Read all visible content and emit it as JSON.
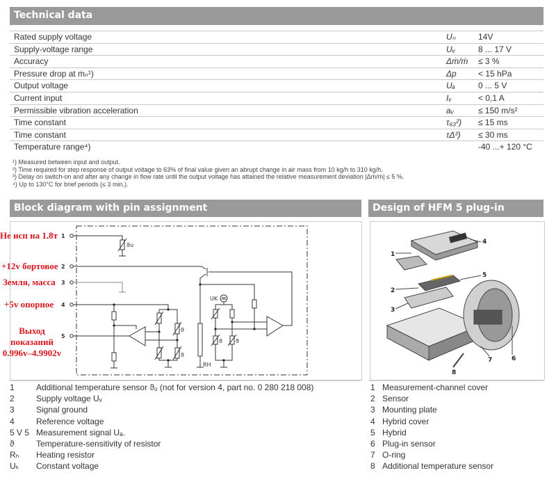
{
  "tech": {
    "title": "Technical data",
    "rows": [
      {
        "label": "Rated supply voltage",
        "symbol": "Uₙ",
        "value": "14V"
      },
      {
        "label": "Supply-voltage range",
        "symbol": "Uᵥ",
        "value": "8 ... 17 V"
      },
      {
        "label": "Accuracy",
        "symbol": "Δṁ/ṁ",
        "value": "≤ 3 %"
      },
      {
        "label": "Pressure drop at ṁₙ¹)",
        "symbol": "Δp",
        "value": "< 15 hPa"
      },
      {
        "label": "Output voltage",
        "symbol": "Uₐ",
        "value": "0 ... 5 V"
      },
      {
        "label": "Current input",
        "symbol": "Iᵥ",
        "value": "< 0,1 A"
      },
      {
        "label": "Permissible vibration acceleration",
        "symbol": "aᵥ",
        "value": "≤ 150 m/s²"
      },
      {
        "label": "Time constant",
        "symbol": "τ₆₃²)",
        "value": "≤ 15 ms"
      },
      {
        "label": "Time constant",
        "symbol": "τΔ³)",
        "value": "≤ 30 ms"
      },
      {
        "label": "Temperature range⁴)",
        "symbol": "",
        "value": "-40 ...+ 120 °C"
      }
    ],
    "footnotes": [
      "¹) Measured between input and output.",
      "²) Time required for step response of output voltage to 63% of final value given an abrupt change in air mass from 10 kg/h to 310 kg/h.",
      "³) Delay on switch-on and after any change in flow rate until the output voltage has attained the relative measurement deviation |Δṁ/ṁ| ≤ 5 %.",
      "⁴) Up to 130°C for brief periods (≤ 3 min.)."
    ]
  },
  "block": {
    "title": "Block diagram with pin assignment",
    "pins": [
      "1",
      "2",
      "3",
      "4",
      "5"
    ],
    "annotations": [
      "Не исп на 1.8т",
      "+12v бортовое",
      "Земля, масса",
      "+5v опорное",
      "Выход",
      "показаний",
      "0.996v–4.9902v"
    ],
    "labels": {
      "theta_u": "ϑu",
      "theta": "ϑ",
      "uk": "UK",
      "rh": "RH"
    },
    "legend": [
      [
        "1",
        "Additional temperature sensor ϑᵤ (not for version 4, part no. 0 280 218 008)"
      ],
      [
        "2",
        "Supply voltage Uᵥ"
      ],
      [
        "3",
        "Signal ground"
      ],
      [
        "4",
        "Reference voltage"
      ],
      [
        "5 V 5",
        "Measurement signal Uₐ."
      ],
      [
        "ϑ",
        "Temperature-sensitivity of resistor"
      ],
      [
        "Rₕ",
        "Heating resistor"
      ],
      [
        "Uₖ",
        "Constant voltage"
      ]
    ]
  },
  "design": {
    "title": "Design of HFM 5 plug-in sensor",
    "callouts": [
      "1",
      "2",
      "3",
      "4",
      "5",
      "6",
      "7",
      "8"
    ],
    "legend": [
      [
        "1",
        "Measurement-channel cover"
      ],
      [
        "2",
        "Sensor"
      ],
      [
        "3",
        "Mounting plate"
      ],
      [
        "4",
        "Hybrid cover"
      ],
      [
        "5",
        "Hybrid"
      ],
      [
        "6",
        "Plug-in sensor"
      ],
      [
        "7",
        "O-ring"
      ],
      [
        "8",
        "Additional temperature sensor"
      ]
    ]
  },
  "colors": {
    "header": "#9a9a9a",
    "annotation": "#d8171e"
  }
}
